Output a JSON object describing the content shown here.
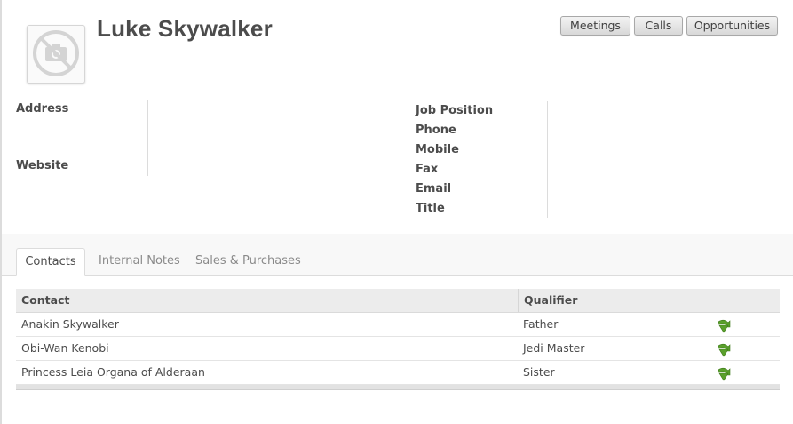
{
  "partner": {
    "name": "Luke Skywalker",
    "avatar_icon": "camera-placeholder-icon"
  },
  "buttons": {
    "meetings": "Meetings",
    "calls": "Calls",
    "opportunities": "Opportunities"
  },
  "fields_left": {
    "address": "Address",
    "website": "Website"
  },
  "fields_right": {
    "job_position": "Job Position",
    "phone": "Phone",
    "mobile": "Mobile",
    "fax": "Fax",
    "email": "Email",
    "title": "Title"
  },
  "tabs": [
    {
      "label": "Contacts",
      "active": true
    },
    {
      "label": "Internal Notes",
      "active": false
    },
    {
      "label": "Sales & Purchases",
      "active": false
    }
  ],
  "contacts_table": {
    "headers": {
      "contact": "Contact",
      "qualifier": "Qualifier"
    },
    "rows": [
      {
        "contact": "Anakin Skywalker",
        "qualifier": "Father"
      },
      {
        "contact": "Obi-Wan Kenobi",
        "qualifier": "Jedi Master"
      },
      {
        "contact": "Princess Leia Organa of Alderaan",
        "qualifier": "Sister"
      }
    ],
    "row_action_icon": "green-arrow-open-icon"
  },
  "colors": {
    "accent_green": "#5aa02c",
    "text": "#4c4c4c"
  }
}
